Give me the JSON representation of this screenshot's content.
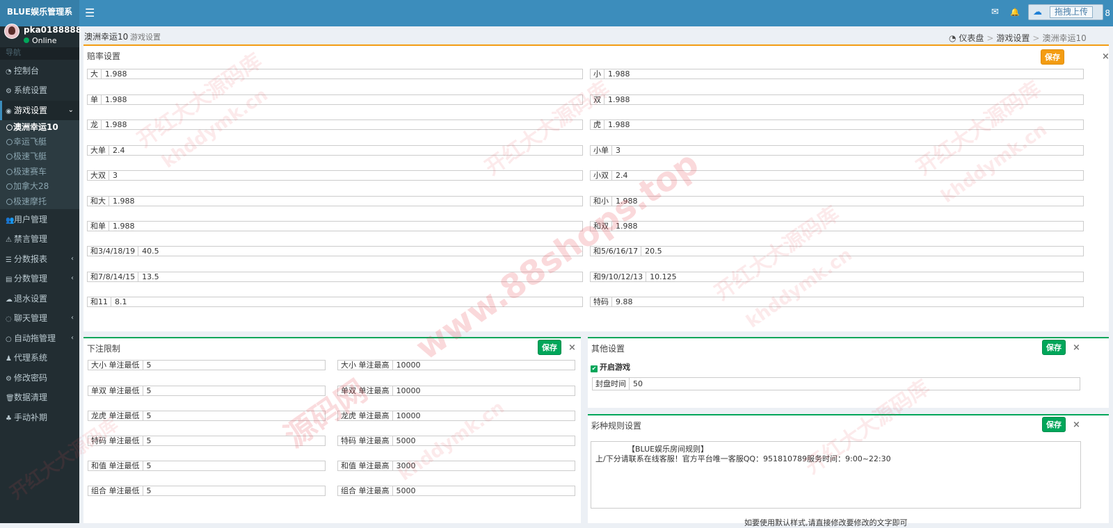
{
  "app": {
    "logo": "BLUE娱乐管理系"
  },
  "topbar": {
    "menu_icon": "☰",
    "mail_icon": "✉",
    "bell_icon": "🔔",
    "user_fragment": "8",
    "upload_label": "拖拽上传"
  },
  "user": {
    "name": "pka0188888",
    "status": "Online"
  },
  "nav": {
    "header": "导航",
    "items": [
      {
        "label": "控制台",
        "icon": "dashboard-icon"
      },
      {
        "label": "系统设置",
        "icon": "cogs-icon"
      },
      {
        "label": "游戏设置",
        "icon": "gamepad-icon"
      },
      {
        "label": "用户管理",
        "icon": "users-icon"
      },
      {
        "label": "禁言管理",
        "icon": "warning-icon"
      },
      {
        "label": "分数报表",
        "icon": "list-icon"
      },
      {
        "label": "分数管理",
        "icon": "database-icon"
      },
      {
        "label": "退水设置",
        "icon": "cloud-icon"
      },
      {
        "label": "聊天管理",
        "icon": "chat-icon"
      },
      {
        "label": "自动拖管理",
        "icon": "comment-icon"
      },
      {
        "label": "代理系统",
        "icon": "user-plus-icon"
      },
      {
        "label": "修改密码",
        "icon": "gear-icon"
      },
      {
        "label": "数据清理",
        "icon": "trash-icon"
      },
      {
        "label": "手动补期",
        "icon": "users-cog-icon"
      }
    ],
    "sub_items": [
      "澳洲幸运10",
      "幸运飞艇",
      "极速飞艇",
      "极速赛车",
      "加拿大28",
      "极速摩托"
    ]
  },
  "page": {
    "title": "澳洲幸运10",
    "subtitle": "游戏设置",
    "breadcrumb": {
      "home": "仪表盘",
      "section": "游戏设置",
      "current": "澳洲幸运10"
    }
  },
  "odds": {
    "title": "赔率设置",
    "save": "保存",
    "close": "×",
    "left": [
      {
        "label": "大",
        "value": "1.988"
      },
      {
        "label": "单",
        "value": "1.988"
      },
      {
        "label": "龙",
        "value": "1.988"
      },
      {
        "label": "大单",
        "value": "2.4"
      },
      {
        "label": "大双",
        "value": "3"
      },
      {
        "label": "和大",
        "value": "1.988"
      },
      {
        "label": "和单",
        "value": "1.988"
      },
      {
        "label": "和3/4/18/19",
        "value": "40.5"
      },
      {
        "label": "和7/8/14/15",
        "value": "13.5"
      },
      {
        "label": "和11",
        "value": "8.1"
      }
    ],
    "right": [
      {
        "label": "小",
        "value": "1.988"
      },
      {
        "label": "双",
        "value": "1.988"
      },
      {
        "label": "虎",
        "value": "1.988"
      },
      {
        "label": "小单",
        "value": "3"
      },
      {
        "label": "小双",
        "value": "2.4"
      },
      {
        "label": "和小",
        "value": "1.988"
      },
      {
        "label": "和双",
        "value": "1.988"
      },
      {
        "label": "和5/6/16/17",
        "value": "20.5"
      },
      {
        "label": "和9/10/12/13",
        "value": "10.125"
      },
      {
        "label": "特码",
        "value": "9.88"
      }
    ]
  },
  "limits": {
    "title": "下注限制",
    "save": "保存",
    "close": "×",
    "rows": [
      {
        "min_label": "大小 单注最低",
        "min": "5",
        "max_label": "大小 单注最高",
        "max": "10000"
      },
      {
        "min_label": "单双 单注最低",
        "min": "5",
        "max_label": "单双 单注最高",
        "max": "10000"
      },
      {
        "min_label": "龙虎 单注最低",
        "min": "5",
        "max_label": "龙虎 单注最高",
        "max": "10000"
      },
      {
        "min_label": "特码 单注最低",
        "min": "5",
        "max_label": "特码 单注最高",
        "max": "5000"
      },
      {
        "min_label": "和值 单注最低",
        "min": "5",
        "max_label": "和值 单注最高",
        "max": "3000"
      },
      {
        "min_label": "组合 单注最低",
        "min": "5",
        "max_label": "组合 单注最高",
        "max": "5000"
      }
    ]
  },
  "other": {
    "title": "其他设置",
    "save": "保存",
    "close": "×",
    "enable_game": "开启游戏",
    "seal_label": "封盘时间",
    "seal_value": "50"
  },
  "rules": {
    "title": "彩种规则设置",
    "save": "保存",
    "close": "×",
    "heading": "【BLUE娱乐房间规则】",
    "body": "上/下分请联系在线客服！官方平台唯一客服QQ：951810789服务时间：9:00~22:30",
    "footer": "如要使用默认样式,请直接修改要修改的文字即可"
  },
  "watermarks": [
    "开红大大源码库",
    "khddymk.cn",
    "www.88shops.top",
    "源码网"
  ]
}
